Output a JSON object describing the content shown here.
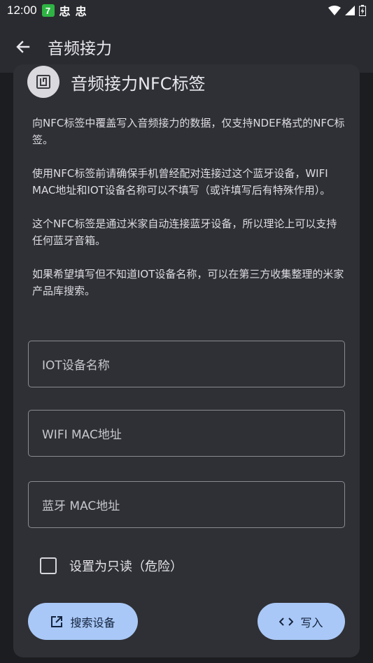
{
  "status_bar": {
    "time": "12:00",
    "badge": "7",
    "bug_glyph": "忠"
  },
  "app_bar": {
    "title": "音频接力",
    "back_icon": "arrow-left-icon"
  },
  "card": {
    "title": "音频接力NFC标签",
    "icon": "nfc-icon",
    "description": [
      "向NFC标签中覆盖写入音频接力的数据，仅支持NDEF格式的NFC标签。",
      "使用NFC标签前请确保手机曾经配对连接过这个蓝牙设备，WIFI MAC地址和IOT设备名称可以不填写（或许填写后有特殊作用）。",
      "这个NFC标签是通过米家自动连接蓝牙设备，所以理论上可以支持任何蓝牙音箱。",
      "如果希望填写但不知道IOT设备名称，可以在第三方收集整理的米家产品库搜索。"
    ]
  },
  "fields": {
    "iot_name": "IOT设备名称",
    "wifi_mac": "WIFI MAC地址",
    "bt_mac": "蓝牙 MAC地址"
  },
  "checkbox": {
    "label": "设置为只读（危险）",
    "checked": false
  },
  "buttons": {
    "search": "搜索设备",
    "write": "写入"
  },
  "colors": {
    "background": "#1c1d21",
    "surface": "#2f3035",
    "app_bar": "#2a2b30",
    "button": "#a9c8f7",
    "button_text": "#13233d"
  }
}
